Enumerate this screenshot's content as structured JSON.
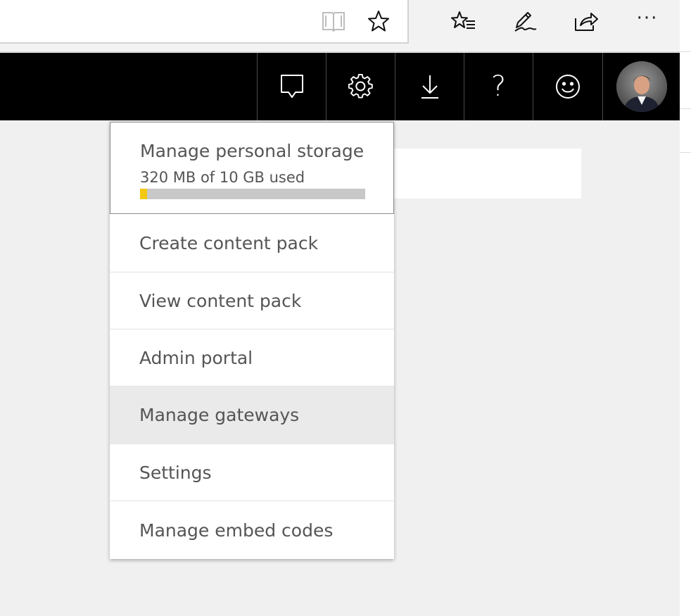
{
  "browser_toolbar": {
    "reading_view_icon": "book-icon",
    "favorite_icon": "star-icon",
    "favorites_list_icon": "star-list-icon",
    "annotate_icon": "pen-icon",
    "share_icon": "share-icon",
    "more_label": "···"
  },
  "header": {
    "buttons": [
      {
        "name": "notifications-button",
        "icon": "chat-bubble-icon"
      },
      {
        "name": "settings-button",
        "icon": "gear-icon"
      },
      {
        "name": "download-button",
        "icon": "download-icon"
      },
      {
        "name": "help-button",
        "icon": "help-icon",
        "glyph": "?"
      },
      {
        "name": "feedback-button",
        "icon": "smiley-icon"
      }
    ],
    "avatar_icon": "user-avatar-icon"
  },
  "settings_menu": {
    "storage": {
      "title": "Manage personal storage",
      "usage": "320 MB of 10 GB used",
      "used_fraction": 0.032,
      "bar_color": "#F2C811"
    },
    "items": [
      {
        "label": "Create content pack"
      },
      {
        "label": "View content pack"
      },
      {
        "label": "Admin portal"
      },
      {
        "label": "Manage gateways",
        "highlighted": true
      },
      {
        "label": "Settings"
      },
      {
        "label": "Manage embed codes"
      }
    ]
  }
}
